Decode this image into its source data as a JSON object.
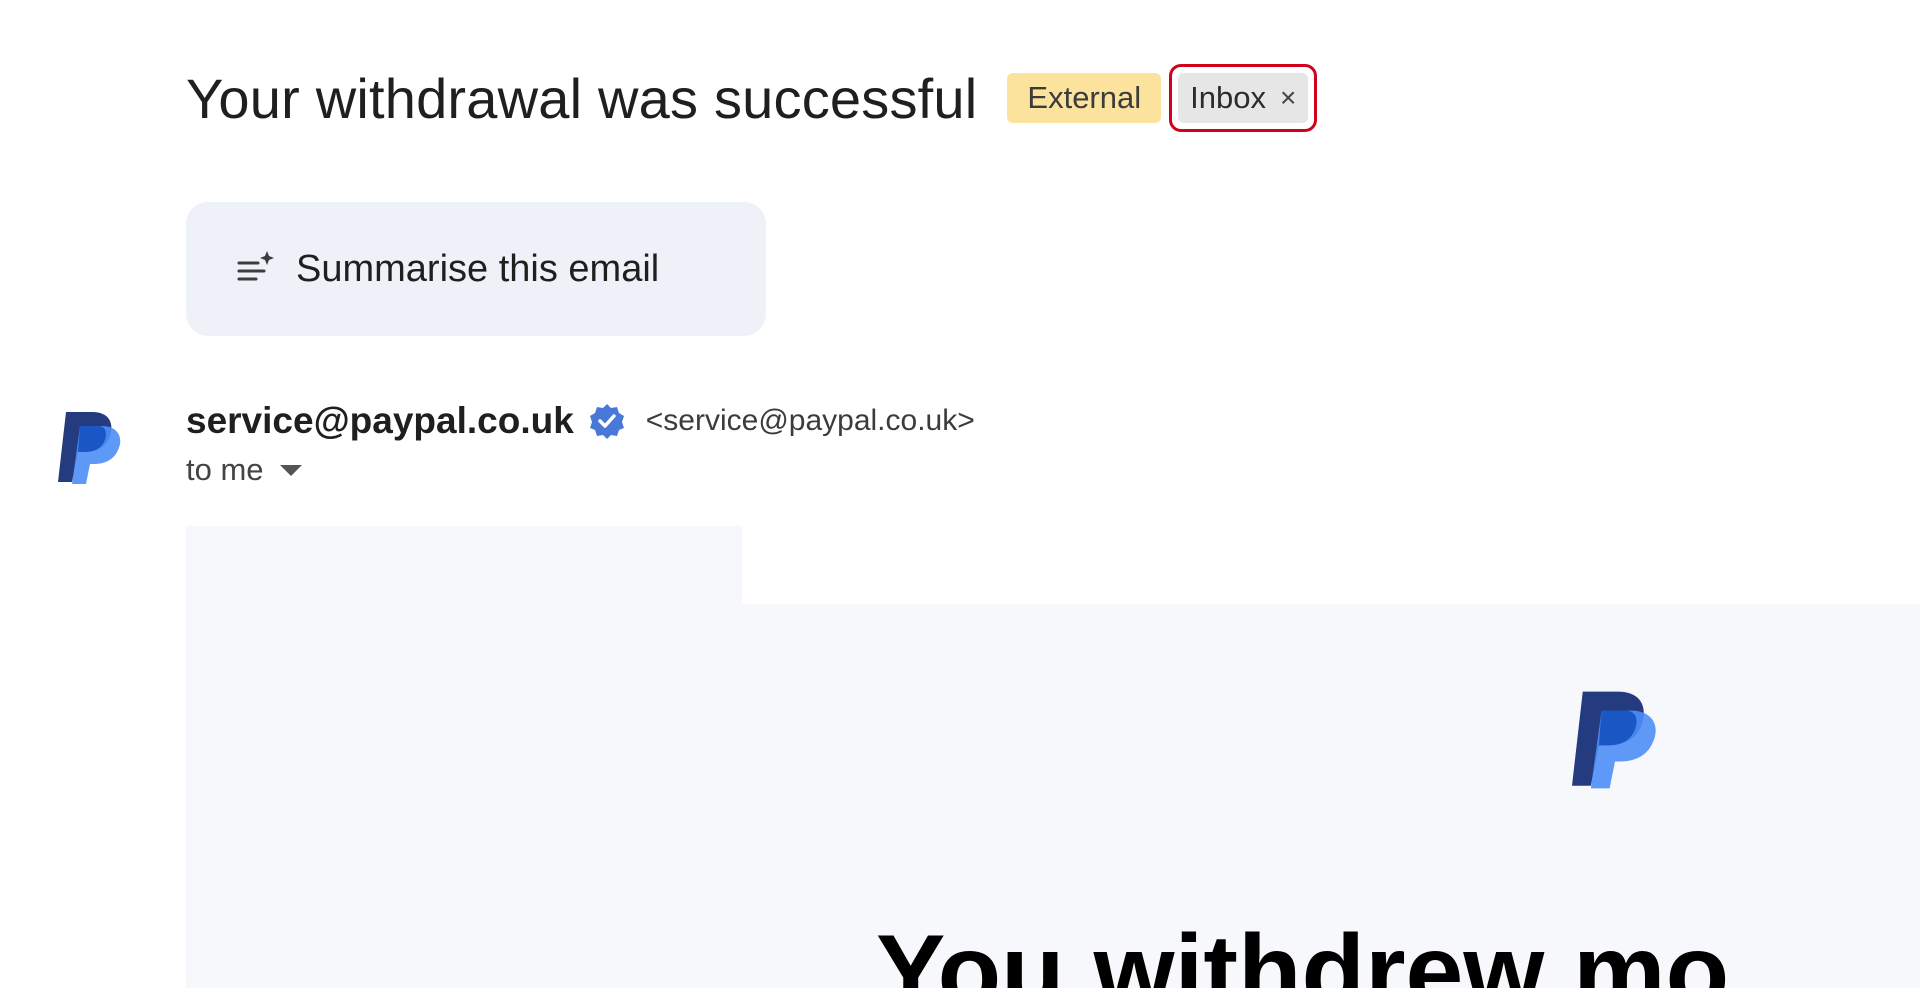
{
  "email": {
    "subject": "Your withdrawal was successful",
    "labels": {
      "external": "External",
      "inbox": "Inbox",
      "inbox_remove": "×"
    },
    "summarise_label": "Summarise this email",
    "sender": {
      "name": "service@paypal.co.uk",
      "email": "<service@paypal.co.uk>",
      "recipient": "to me",
      "avatar_icon": "paypal-logo-icon",
      "verified_icon": "verified-badge-icon"
    },
    "body": {
      "heading": "You withdrew mo"
    }
  },
  "colors": {
    "external_label": "#fbe29d",
    "inbox_label": "#e6e6e6",
    "highlight_border": "#d0021b",
    "summarise_bg": "#eef1f8",
    "paypal_dark": "#253b80",
    "paypal_light": "#179bd7",
    "verified": "#4a78d8"
  }
}
